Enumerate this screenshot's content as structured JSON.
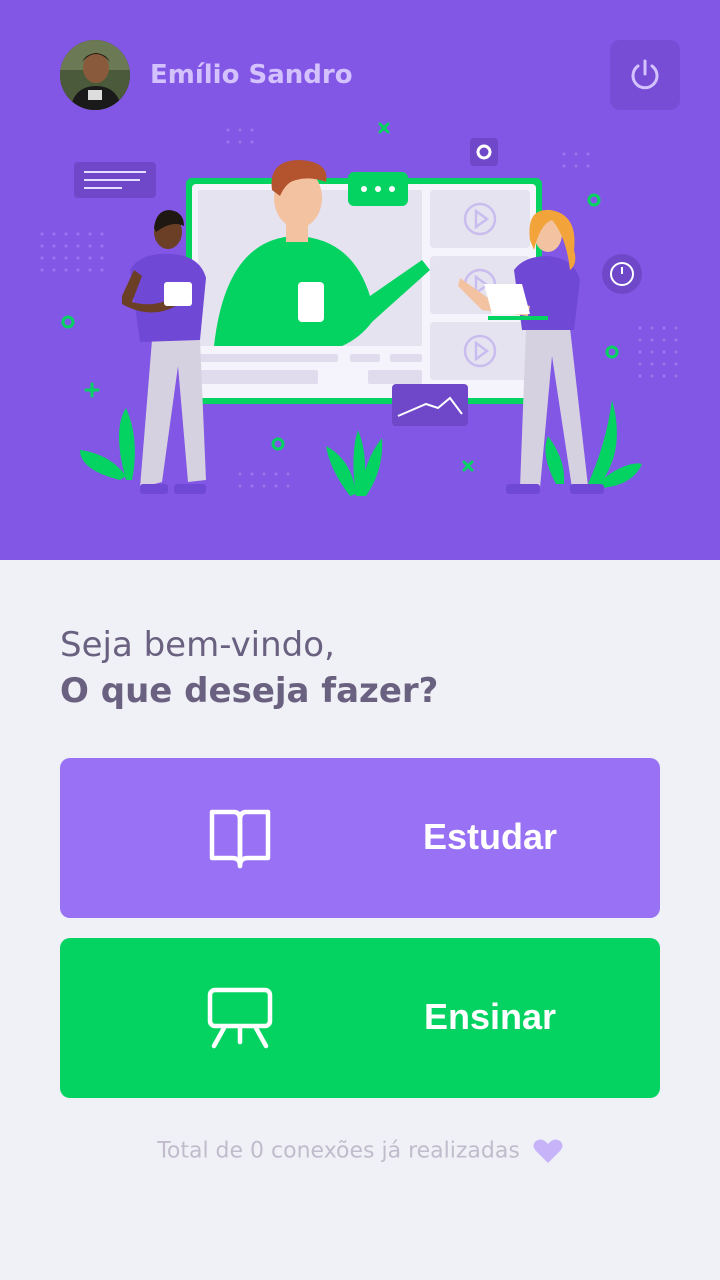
{
  "header": {
    "user_name": "Emílio Sandro",
    "avatar_icon": "user-avatar",
    "logout_icon": "power-icon"
  },
  "greeting": {
    "line1": "Seja bem-vindo,",
    "line2": "O que deseja fazer?"
  },
  "actions": [
    {
      "label": "Estudar",
      "icon": "book-open-icon",
      "color": "#9871f5"
    },
    {
      "label": "Ensinar",
      "icon": "presentation-board-icon",
      "color": "#04d361"
    }
  ],
  "footer": {
    "text": "Total de 0 conexões já realizadas",
    "icon": "heart-icon"
  },
  "colors": {
    "primary": "#8257e5",
    "primary_light": "#9871f5",
    "secondary": "#04d361",
    "background": "#f0f0f7",
    "text_title": "#6a6180",
    "text_muted": "#c1bccc",
    "name_text": "#d4c2ff"
  }
}
